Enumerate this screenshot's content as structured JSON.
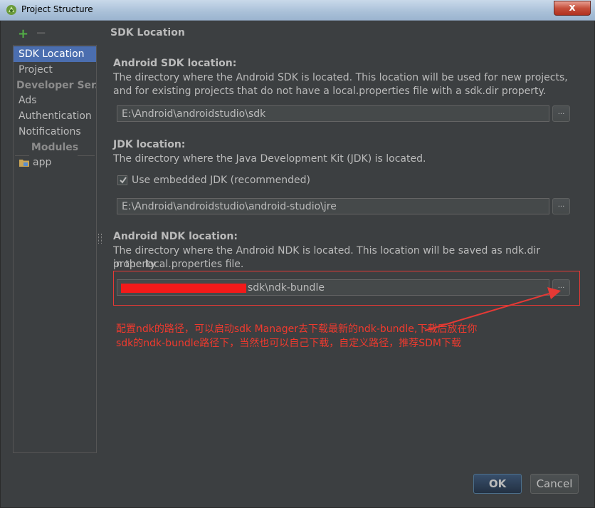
{
  "window": {
    "title": "Project Structure",
    "close_label": "x"
  },
  "sidebar": {
    "add_label": "+",
    "remove_label": "−",
    "items": [
      {
        "label": "SDK Location"
      },
      {
        "label": "Project"
      },
      {
        "label": "Developer Ser..."
      },
      {
        "label": "Ads"
      },
      {
        "label": "Authentication"
      },
      {
        "label": "Notifications"
      },
      {
        "label": "Modules"
      },
      {
        "label": "app"
      }
    ]
  },
  "main": {
    "heading": "SDK Location",
    "sdk": {
      "title": "Android SDK location:",
      "desc_line1": "The directory where the Android SDK is located. This location will be used for new projects,",
      "desc_line2": "and for existing projects that do not have a local.properties file with a sdk.dir property.",
      "path": "E:\\Android\\androidstudio\\sdk",
      "browse_label": "..."
    },
    "jdk": {
      "title": "JDK location:",
      "desc": "The directory where the Java Development Kit (JDK) is located.",
      "checkbox_label": "Use embedded JDK (recommended)",
      "checked": true,
      "path": "E:\\Android\\androidstudio\\android-studio\\jre",
      "browse_label": "..."
    },
    "ndk": {
      "title": "Android NDK location:",
      "desc_line1": "The directory where the Android NDK is located. This location will be saved as ndk.dir property",
      "desc_line2": "in the local.properties file.",
      "path": "sdk\\ndk-bundle",
      "browse_label": "..."
    },
    "annotation": {
      "line1": "配置ndk的路径，可以启动sdk Manager去下载最新的ndk-bundle,下载后放在你",
      "line2": "sdk的ndk-bundle路径下，当然也可以自己下载，自定义路径，推荐SDM下载",
      "color": "#f03a2e"
    }
  },
  "footer": {
    "ok_label": "OK",
    "cancel_label": "Cancel"
  },
  "colors": {
    "background": "#3c3f41",
    "selection": "#4b6eaf",
    "text": "#bbbbbb",
    "annotation_red": "#e53935"
  }
}
